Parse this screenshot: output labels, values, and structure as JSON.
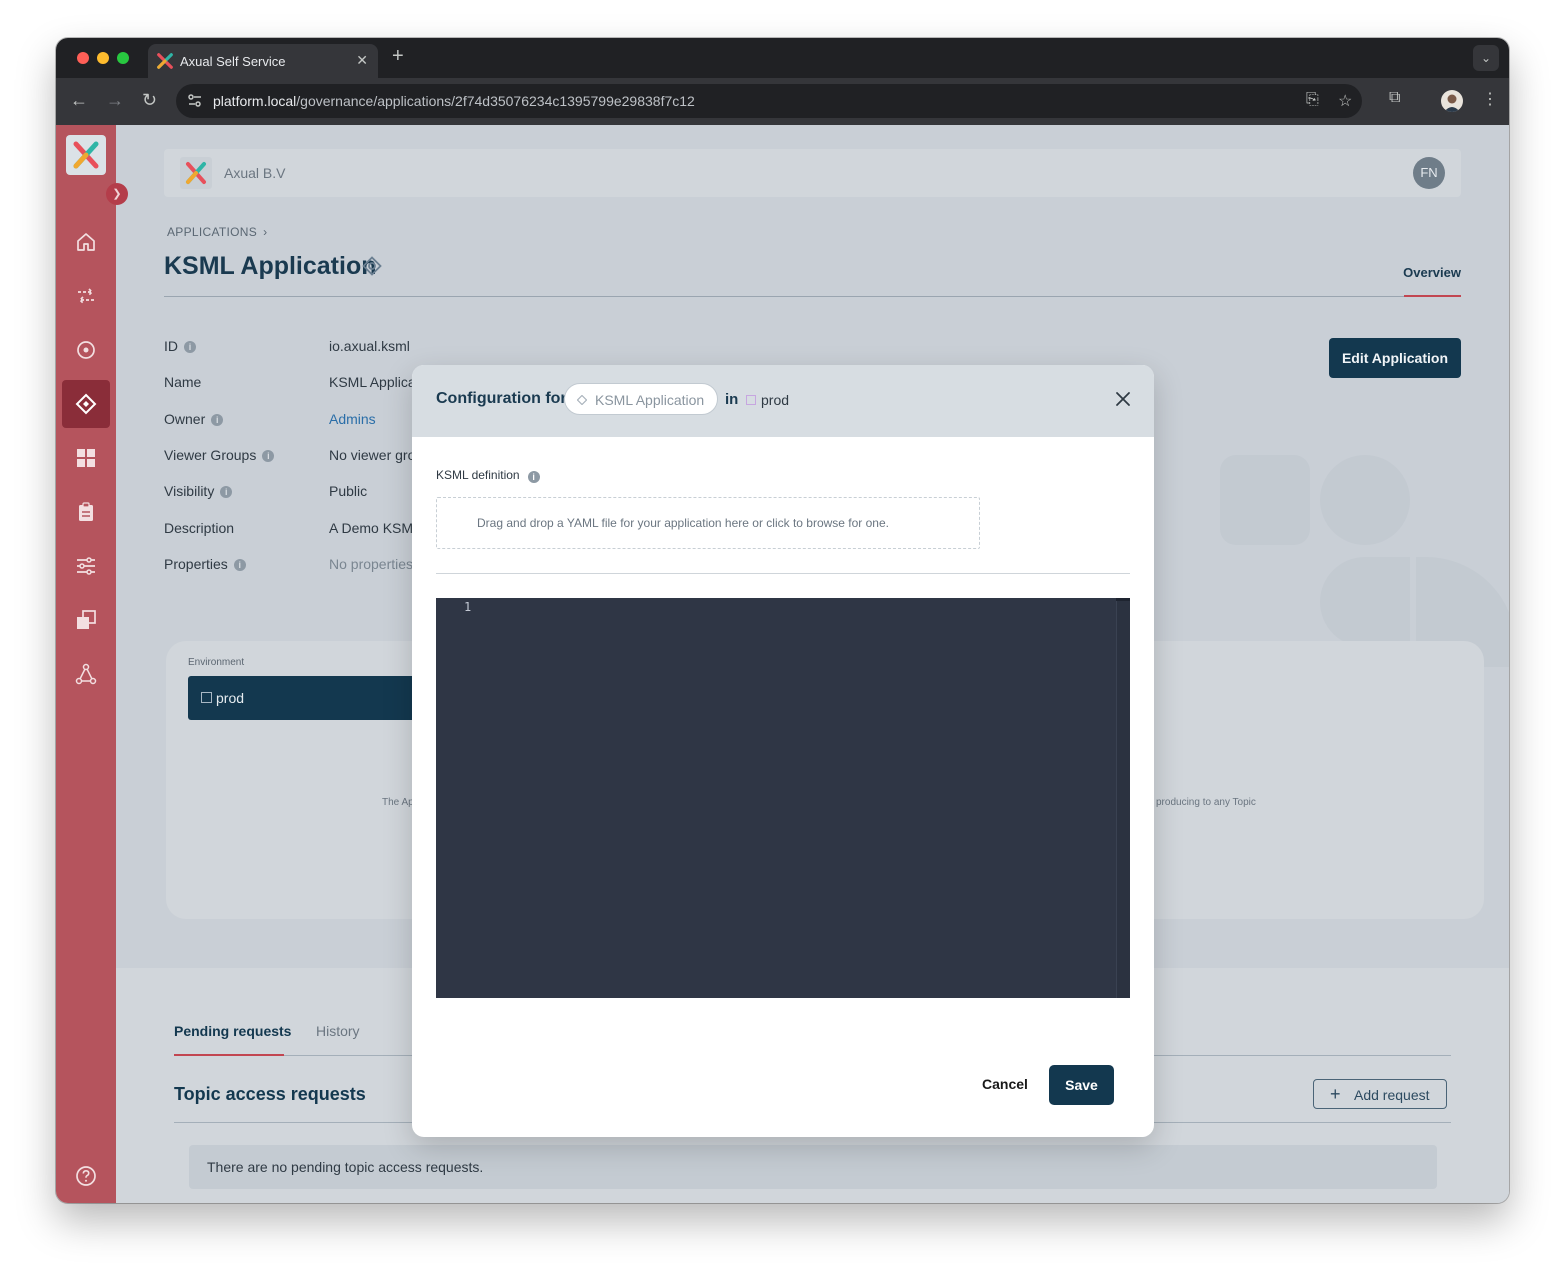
{
  "browser": {
    "tab_title": "Axual Self Service",
    "url_host": "platform.local",
    "url_path": "/governance/applications/2f74d35076234c1395799e29838f7c12"
  },
  "header": {
    "org_name": "Axual B.V",
    "avatar_initials": "FN"
  },
  "breadcrumb": {
    "section": "APPLICATIONS"
  },
  "page": {
    "title": "KSML Application",
    "tab_overview": "Overview",
    "edit_button": "Edit Application"
  },
  "properties": [
    {
      "label": "ID",
      "value": "io.axual.ksml",
      "info": true
    },
    {
      "label": "Name",
      "value": "KSML Applica",
      "info": false
    },
    {
      "label": "Owner",
      "value": "Admins",
      "info": true
    },
    {
      "label": "Viewer Groups",
      "value": "No viewer gro",
      "info": true
    },
    {
      "label": "Visibility",
      "value": "Public",
      "info": true
    },
    {
      "label": "Description",
      "value": "A Demo KSM",
      "info": false
    },
    {
      "label": "Properties",
      "value": "No properties",
      "info": true
    }
  ],
  "environment": {
    "label": "Environment",
    "selected": "prod",
    "text_left": "The Ap",
    "text_right": "producing to any Topic"
  },
  "lower": {
    "tab_pending": "Pending requests",
    "tab_history": "History",
    "topic_title": "Topic access requests",
    "add_request": "Add request",
    "empty_text": "There are no pending topic access requests."
  },
  "modal": {
    "title": "Configuration for",
    "app_pill": "KSML Application",
    "in_label": "in",
    "env": "prod",
    "ksml_label": "KSML definition",
    "dropzone_text": "Drag and drop a YAML file for your application here or click to browse for one.",
    "line_number": "1",
    "cancel": "Cancel",
    "save": "Save"
  },
  "colors": {
    "sidebar": "#b5545d",
    "primary": "#13384f",
    "accent": "#c24651"
  }
}
